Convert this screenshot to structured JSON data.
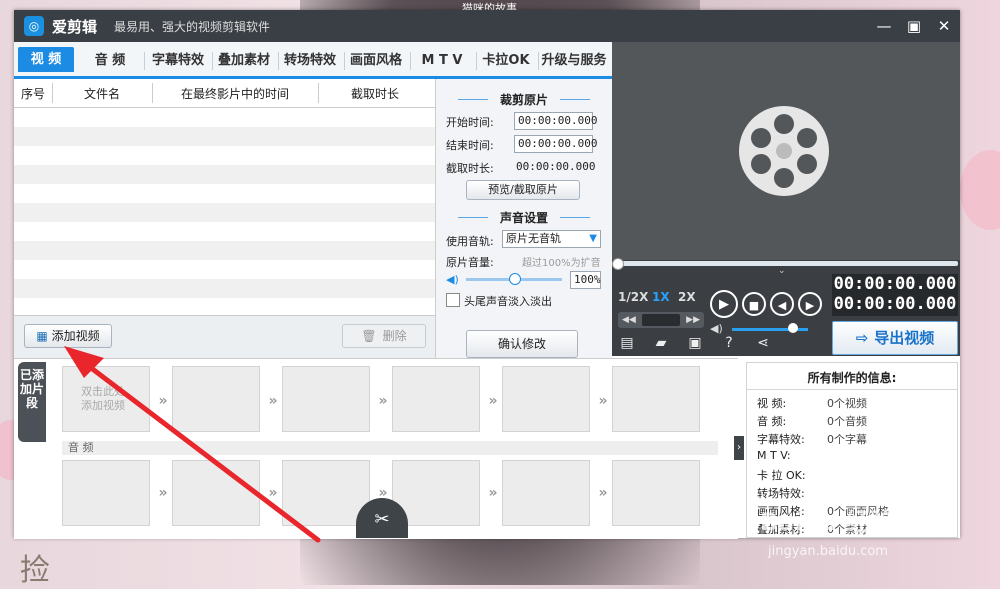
{
  "background": {
    "top_caption": "猫咪的故事",
    "corner_text": "捡"
  },
  "app": {
    "name": "爱剪辑",
    "slogan": "最易用、强大的视频剪辑软件",
    "logo_glyph": "◎"
  },
  "window_controls": {
    "minimize": "—",
    "maximize": "▣",
    "close": "✕"
  },
  "tabs": [
    {
      "label": "视  频",
      "active": true
    },
    {
      "label": "音  频",
      "active": false
    },
    {
      "label": "字幕特效",
      "active": false
    },
    {
      "label": "叠加素材",
      "active": false
    },
    {
      "label": "转场特效",
      "active": false
    },
    {
      "label": "画面风格",
      "active": false
    },
    {
      "label": "M T V",
      "active": false
    },
    {
      "label": "卡拉OK",
      "active": false
    },
    {
      "label": "升级与服务",
      "active": false
    }
  ],
  "file_table": {
    "columns": [
      "序号",
      "文件名",
      "在最终影片中的时间",
      "截取时长"
    ],
    "rows": []
  },
  "file_panel": {
    "add_video": "添加视频",
    "delete": "删除"
  },
  "trim": {
    "title": "裁剪原片",
    "start_label": "开始时间:",
    "start_value": "00:00:00.000",
    "end_label": "结束时间:",
    "end_value": "00:00:00.000",
    "duration_label": "截取时长:",
    "duration_value": "00:00:00.000",
    "preview_button": "预览/截取原片"
  },
  "sound": {
    "title": "声音设置",
    "track_label": "使用音轨:",
    "track_value": "原片无音轨",
    "volume_label": "原片音量:",
    "volume_hint": "超过100%为扩音",
    "volume_value": "100%",
    "volume_level": 0.5,
    "fade_label": "头尾声音淡入淡出",
    "confirm_button": "确认修改"
  },
  "player": {
    "speeds": [
      {
        "label": "1/2X",
        "active": false
      },
      {
        "label": "1X",
        "active": true
      },
      {
        "label": "2X",
        "active": false
      }
    ],
    "time_current": "00:00:00.000",
    "time_total": "00:00:00.000",
    "play": "▶",
    "stop": "■",
    "prev": "◀",
    "next": "▶",
    "volume_level": 0.8
  },
  "export_button": "导出视频",
  "timeline": {
    "side_tab": "已添加片段",
    "slot_hint": "双击此处添加视频",
    "audio_label": "音 频",
    "cut_icon": "✂"
  },
  "info_panel": {
    "title": "所有制作的信息:",
    "rows": [
      {
        "label": "视    频:",
        "value": "0个视频"
      },
      {
        "label": "音    频:",
        "value": "0个音频"
      },
      {
        "label": "字幕特效:",
        "value": "0个字幕"
      },
      {
        "label": "M  T  V:",
        "value": ""
      },
      {
        "label": "卡 拉 OK:",
        "value": ""
      },
      {
        "label": "转场特效:",
        "value": ""
      },
      {
        "label": "画面风格:",
        "value": "0个画面风格"
      },
      {
        "label": "叠加素材:",
        "value": "0个素材"
      }
    ]
  },
  "watermark": {
    "line1": "Baidu 经验",
    "line2": "jingyan.baidu.com"
  },
  "colors": {
    "accent": "#1c8be4",
    "titlebar": "#3a3f45",
    "player_bg": "#54575a",
    "annotation_arrow": "#e8262b"
  }
}
